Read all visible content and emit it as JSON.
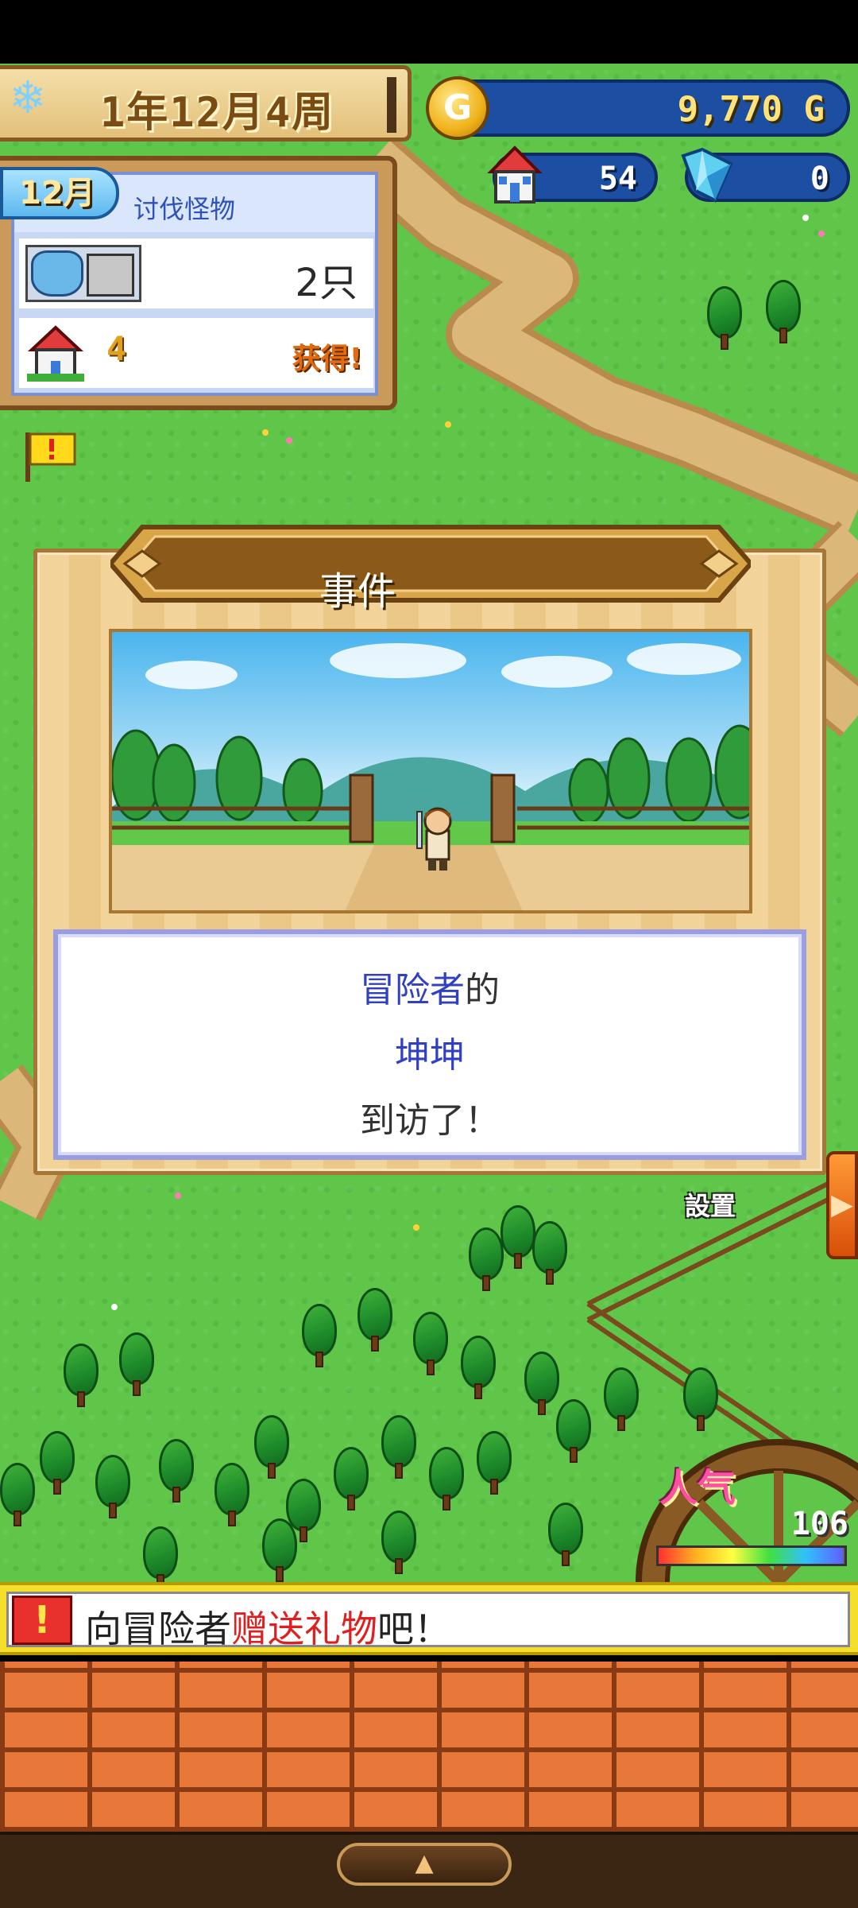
{
  "hud": {
    "date": "1年12月4周",
    "gold": "9,770 G",
    "houses": "54",
    "crystals": "0",
    "gold_icon_glyph": "G"
  },
  "quest": {
    "month": "12月",
    "title": "讨伐怪物",
    "monster_count": "2只",
    "reward_count": "4",
    "reward_status": "获得!"
  },
  "event": {
    "title": "事件",
    "message_part1": "冒险者",
    "message_part2": "的",
    "adventurer_name": "坤坤",
    "message_line3": "到访了！"
  },
  "controls": {
    "settings": "設置",
    "side_arrow": "▶",
    "expand_arrow": "▲"
  },
  "popularity": {
    "label": "人气",
    "value": "106",
    "meter_fill": 0.99
  },
  "hint": {
    "icon_glyph": "!",
    "prefix": "向冒险者",
    "highlight": "赠送礼物",
    "suffix": "吧！"
  },
  "colors": {
    "grass": "#5fc64a",
    "path": "#dcb77a",
    "hint_highlight": "#e02020",
    "message_blue": "#3040c0"
  }
}
